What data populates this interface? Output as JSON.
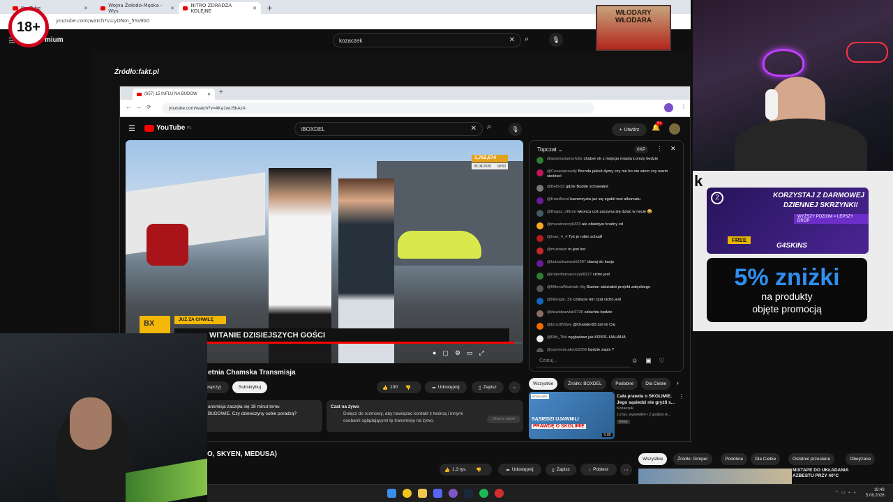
{
  "badge_18": "18+",
  "outer": {
    "tabs": [
      {
        "label": "YouTube"
      },
      {
        "label": "Wojna Żołodo-Męska - Wys"
      },
      {
        "label": "NITRO ZDRADZA KOLEJNE"
      }
    ],
    "url": "youtube.com/watch?v=yONm_5Ss9b0",
    "logo_suffix": "mium",
    "search_value": "kozaczek",
    "source_label": "Źródło:fakt.pl"
  },
  "inner": {
    "tab_label": "(657) 15 INFLU NA BUDOW",
    "url": "youtube.com/watch?v=4Ka1wU5kAzA",
    "logo": "YouTube",
    "logo_region": "PL",
    "search_value": "\\BOXDEL",
    "create_label": "Utwórz",
    "notif_count": "9+",
    "video": {
      "view_counter": "1,762,674",
      "date": "05.08.2026",
      "time": "18:50",
      "overlay_tag": "JUŻ ZA CHWILĘ",
      "overlay_title": "WITANIE DZISIEJSZYCH GOŚCI",
      "live_label": "żywo",
      "brand": "BX"
    },
    "title": "etnia Chamska Transmisja",
    "support_label": "esprzyj",
    "subscribe_label": "Subskrybuj",
    "likes": "100",
    "share_label": "Udostępnij",
    "save_label": "Zapisz",
    "desc_line1": "ansmisja zaczęła się 18 minut temu",
    "desc_line2": "BUDOWIE. Czy dziewczyny sobie poradzą?",
    "live_chat": {
      "title": "Czat na żywo",
      "text1": "Dołącz do rozmowy, aby nawiązać kontakt z twórcą i innymi",
      "text2": "osobami oglądającymi tę transmisję na żywo.",
      "button": "Otwórz panel"
    },
    "chat": {
      "header": "Topczat",
      "points": "0XP",
      "input_placeholder": "Czatuj...",
      "messages": [
        {
          "user": "@adamadama-fu8z",
          "text": "chuber ok z mojego miasta Łomży będzie",
          "color": "#2e7d32"
        },
        {
          "user": "@Cesarzprawdy",
          "text": "Brenda jakieś dymy czy nie bo nie wiem czy warto siedzieć",
          "color": "#c2185b"
        },
        {
          "user": "@Betix32",
          "text": "gdzie Budde schowałeś",
          "color": "#777777"
        },
        {
          "user": "@KranBond",
          "text": "kamerzysta już się zgubił test alkomatu",
          "color": "#6a1b9a"
        },
        {
          "user": "@Bogas_official",
          "text": "wkoncu coś zaczyna się dziać w necie 😀",
          "color": "#455a64"
        },
        {
          "user": "@maratonczyk333",
          "text": "ale obiektyw brudny xd",
          "color": "#f9a825"
        },
        {
          "user": "@ivan_4_4",
          "text": "Tyś je robin schudł",
          "color": "#b71c1c"
        },
        {
          "user": "@mustaszi",
          "text": "to jest kot",
          "color": "#c62828"
        },
        {
          "user": "@kubaolszewski2907",
          "text": "dawaj do kasjo",
          "color": "#6a1b9a"
        },
        {
          "user": "@robertbanaszczyk8227",
          "text": "cicho jest",
          "color": "#2e7d32"
        },
        {
          "user": "@MilenaWoźniak-r6g",
          "text": "Baxton widziałeś projekt załęckiego",
          "color": "#555555"
        },
        {
          "user": "@Nieogar_56",
          "text": "czytacie ten czat cicho jest",
          "color": "#1565c0"
        },
        {
          "user": "@dawidpawluk9736",
          "text": "szlachta będzie",
          "color": "#8d6e63"
        },
        {
          "user": "@bna1899wy",
          "text": "@Orander93 żal mi Cię",
          "color": "#ef6c00"
        },
        {
          "user": "@Riki_Tikii",
          "text": "wyglądasz jak KRISS..HAHAHA",
          "color": "#eeeeee"
        },
        {
          "user": "@szymonrudecki2356",
          "text": "będzie zapis ?",
          "color": "#555555"
        },
        {
          "user": "@adamk7559",
          "text": "Taazy musi drinka wypić",
          "color": "#2e7d32"
        }
      ]
    },
    "filters": [
      "Wszystkie",
      "Źródło: BOXDEL",
      "Podobne",
      "Dla Ciebie"
    ],
    "rec": {
      "title1": "Cała prawda o SKOLIMIE.",
      "title2": "Jego sąsiedzi nie gryźli s...",
      "channel": "Kozaczek",
      "meta": "1,9 tys. wyświetleń • 2 godziny te...",
      "badge": "Nowy",
      "duration": "6:05",
      "thumb_text1": "SĄSIEDZI UJAWNILI",
      "thumb_text2": "PRAWDĘ O SKOLIMIE",
      "thumb_tag": "KOZACZEK"
    }
  },
  "outer_bottom": {
    "title": "O, SKYEN, MEDUSA)",
    "likes": "1,3 tys.",
    "share_label": "Udostępnij",
    "save_label": "Zapisz",
    "download_label": "Pobierz",
    "filters": [
      "Wszystkie",
      "Źródło: Gimper",
      "Podobne",
      "Dla Ciebie",
      "Ostatnio przesłane",
      "Obejrzane"
    ],
    "rec_title1": "MIXTAPE DO UKŁADANIA",
    "rec_title2": "AZBESTU PRZY 40°C"
  },
  "overlays": {
    "banner": "WŁODARY WŁODARA",
    "ad_title1": "KORZYSTAJ Z DARMOWEJ",
    "ad_title2": "DZIENNEJ SKRZYNKI!",
    "ad_sub": "WYŻSZY POZIOM = LEPSZY DROP",
    "ad_free": "FREE",
    "ad_brand": "G4SKINS",
    "ad_level": "2",
    "ad_letter": "k",
    "promo_big": "5% zniżki",
    "promo_line1": "na produkty",
    "promo_line2": "objęte promocją"
  },
  "taskbar": {
    "time": "18:48",
    "date": "5.08.2026"
  }
}
